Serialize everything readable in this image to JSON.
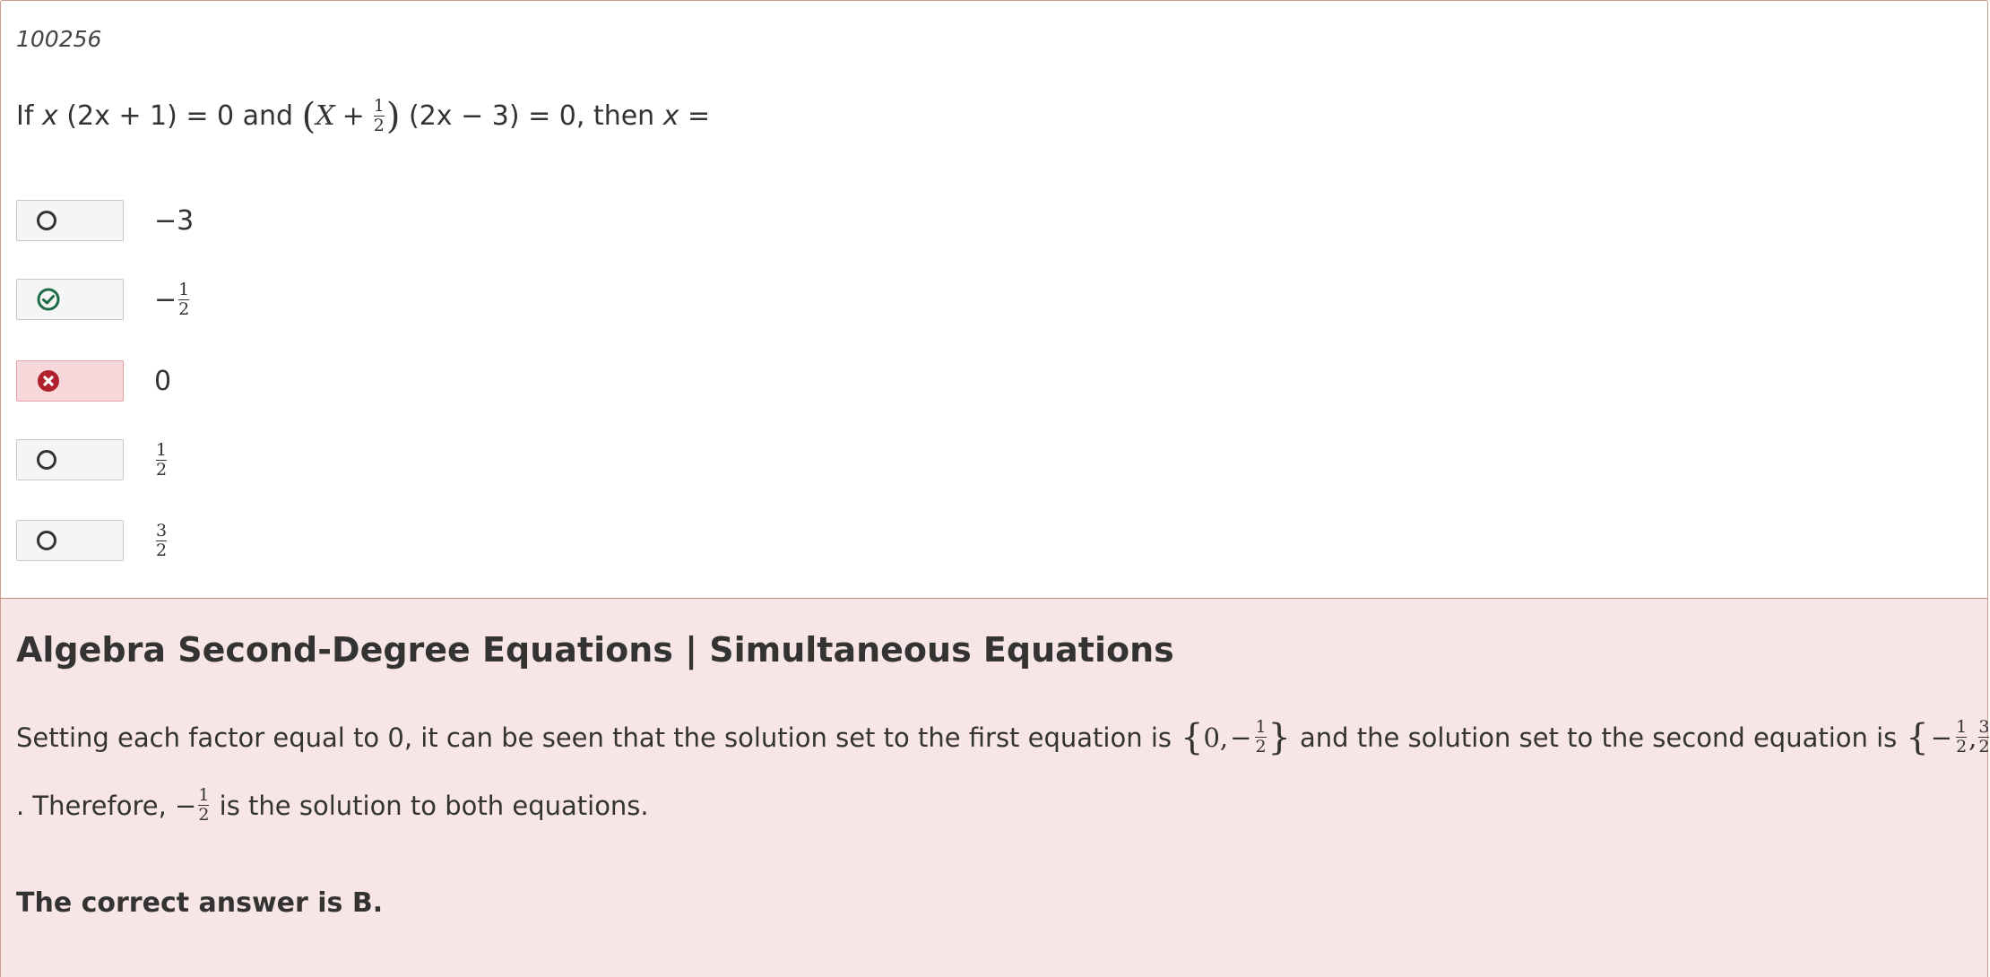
{
  "question": {
    "id": "100256",
    "stem": {
      "prefix": "If",
      "x1": "x",
      "part1": "(2x  + 1) = 0 and",
      "X": "X",
      "plus": "+",
      "half_num": "1",
      "half_den": "2",
      "part2": "(2x  − 3) = 0, then",
      "x2": "x",
      "eq": "="
    },
    "choices": [
      {
        "state": "unselected",
        "icon": "radio-empty-icon",
        "label": "−3"
      },
      {
        "state": "correct",
        "icon": "check-circle-icon",
        "sign": "−",
        "num": "1",
        "den": "2"
      },
      {
        "state": "wrong",
        "icon": "x-circle-icon",
        "label": "0"
      },
      {
        "state": "unselected",
        "icon": "radio-empty-icon",
        "num": "1",
        "den": "2"
      },
      {
        "state": "unselected",
        "icon": "radio-empty-icon",
        "num": "3",
        "den": "2"
      }
    ]
  },
  "explanation": {
    "topic": "Algebra Second-Degree Equations | Simultaneous Equations",
    "line1_a": "Setting each factor equal to 0, it can be seen that the solution set to the first equation is",
    "set1": {
      "first": "0,",
      "sign": "−",
      "num": "1",
      "den": "2"
    },
    "line1_b": "and the solution set to the second equation is",
    "set2": {
      "sign": "−",
      "num1": "1",
      "den1": "2",
      "comma": ",",
      "num2": "3",
      "den2": "2"
    },
    "line2_a": ". Therefore,",
    "line2_sign": "−",
    "line2_num": "1",
    "line2_den": "2",
    "line2_b": "is the solution to both equations.",
    "answer": "The correct answer is B."
  },
  "colors": {
    "correct": "#1e6b47",
    "wrong": "#b0212e",
    "wrong_bg": "#f8d7da",
    "explanation_bg": "#f8e6e6"
  }
}
